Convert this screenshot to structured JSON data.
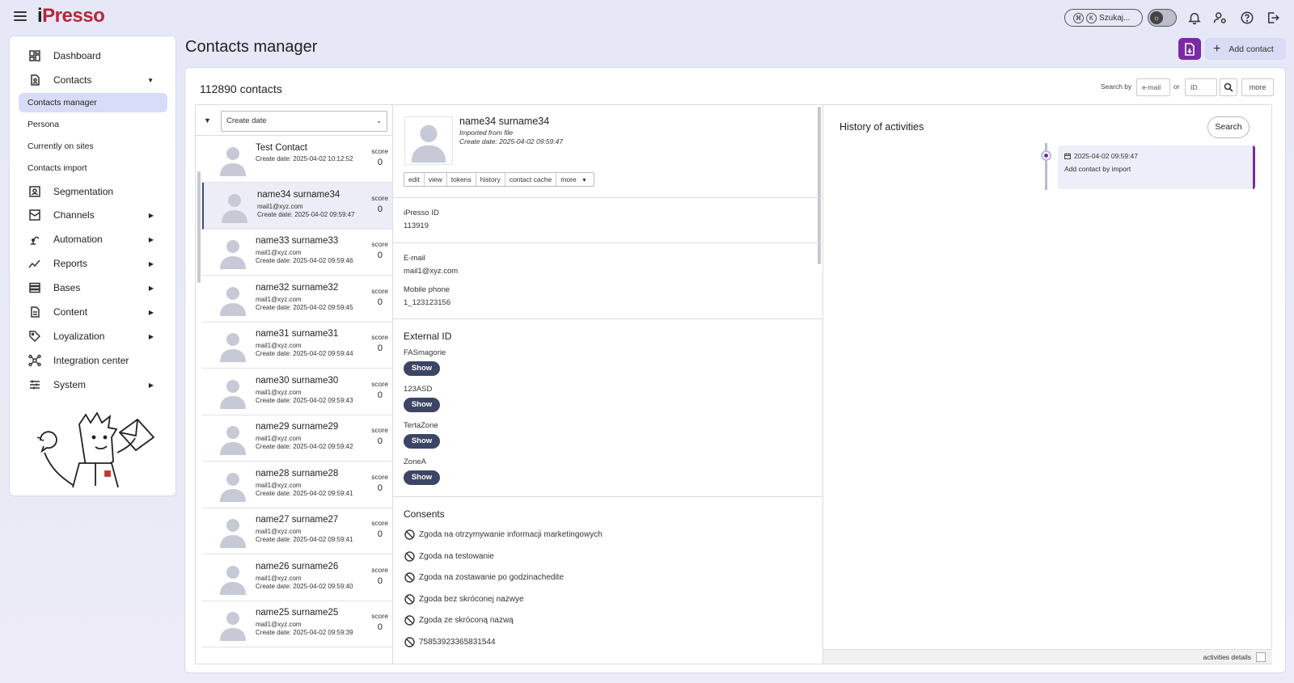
{
  "app": {
    "logo_i": "i",
    "logo_text": "Presso"
  },
  "topbar": {
    "search_text": "Szukaj...",
    "kbd1": "⌘",
    "kbd2": "K"
  },
  "sidebar": {
    "items": [
      {
        "label": "Dashboard",
        "icon": "dashboard-icon"
      },
      {
        "label": "Contacts",
        "icon": "contacts-icon"
      },
      {
        "label": "Segmentation",
        "icon": "segmentation-icon"
      },
      {
        "label": "Channels",
        "icon": "channels-icon"
      },
      {
        "label": "Automation",
        "icon": "automation-icon"
      },
      {
        "label": "Reports",
        "icon": "reports-icon"
      },
      {
        "label": "Bases",
        "icon": "bases-icon"
      },
      {
        "label": "Content",
        "icon": "content-icon"
      },
      {
        "label": "Loyalization",
        "icon": "loyalization-icon"
      },
      {
        "label": "Integration center",
        "icon": "integration-icon"
      },
      {
        "label": "System",
        "icon": "system-icon"
      }
    ],
    "subitems": [
      "Contacts manager",
      "Persona",
      "Currently on sites",
      "Contacts import"
    ]
  },
  "header": {
    "title": "Contacts manager",
    "add_contact": "Add contact"
  },
  "toolbar": {
    "count": "112890 contacts",
    "search_by": "Search by",
    "email_placeholder": "e-mail",
    "or": "or",
    "id_placeholder": "ID",
    "more": "more"
  },
  "list": {
    "sort_value": "Create date",
    "score_label": "score",
    "contacts": [
      {
        "name": "Test Contact",
        "mail": "",
        "date": "Create date: 2025-04-02 10:12:52",
        "score": "0"
      },
      {
        "name": "name34 surname34",
        "mail": "mail1@xyz.com",
        "date": "Create date: 2025-04-02 09:59:47",
        "score": "0"
      },
      {
        "name": "name33 surname33",
        "mail": "mail1@xyz.com",
        "date": "Create date: 2025-04-02 09:59:46",
        "score": "0"
      },
      {
        "name": "name32 surname32",
        "mail": "mail1@xyz.com",
        "date": "Create date: 2025-04-02 09:59:45",
        "score": "0"
      },
      {
        "name": "name31 surname31",
        "mail": "mail1@xyz.com",
        "date": "Create date: 2025-04-02 09:59:44",
        "score": "0"
      },
      {
        "name": "name30 surname30",
        "mail": "mail1@xyz.com",
        "date": "Create date: 2025-04-02 09:59:43",
        "score": "0"
      },
      {
        "name": "name29 surname29",
        "mail": "mail1@xyz.com",
        "date": "Create date: 2025-04-02 09:59:42",
        "score": "0"
      },
      {
        "name": "name28 surname28",
        "mail": "mail1@xyz.com",
        "date": "Create date: 2025-04-02 09:59:41",
        "score": "0"
      },
      {
        "name": "name27 surname27",
        "mail": "mail1@xyz.com",
        "date": "Create date: 2025-04-02 09:59:41",
        "score": "0"
      },
      {
        "name": "name26 surname26",
        "mail": "mail1@xyz.com",
        "date": "Create date: 2025-04-02 09:59:40",
        "score": "0"
      },
      {
        "name": "name25 surname25",
        "mail": "mail1@xyz.com",
        "date": "Create date: 2025-04-02 09:59:39",
        "score": "0"
      }
    ]
  },
  "detail": {
    "name": "name34 surname34",
    "imported": "Imported from file",
    "created": "Create date: 2025-04-02 09:59:47",
    "tabs": [
      "edit",
      "view",
      "tokens",
      "history",
      "contact cache",
      "more"
    ],
    "ipresso_id_label": "iPresso ID",
    "ipresso_id": "113919",
    "email_label": "E-mail",
    "email": "mail1@xyz.com",
    "phone_label": "Mobile phone",
    "phone": "1_123123156",
    "external_title": "External ID",
    "external": [
      "FASmagorie",
      "123ASD",
      "TertaZone",
      "ZoneA"
    ],
    "show": "Show",
    "consents_title": "Consents",
    "consents": [
      "Zgoda na otrzymywanie informacji marketingowych",
      "Zgoda na testowanie",
      "Zgoda na zostawanie po godzinachedite",
      "Zgoda bez skróconej nazwye",
      "Zgoda ze skróconą nazwą",
      "75853923365831544"
    ]
  },
  "history": {
    "title": "History of activities",
    "search": "Search",
    "entry_date": "2025-04-02 09:59:47",
    "entry_desc": "Add contact by import",
    "footer": "activities details"
  },
  "colors": {
    "accent": "#7a2aa6",
    "brand_red": "#b3283a",
    "show_button": "#3c4563",
    "active_nav": "#d9dcf8"
  }
}
